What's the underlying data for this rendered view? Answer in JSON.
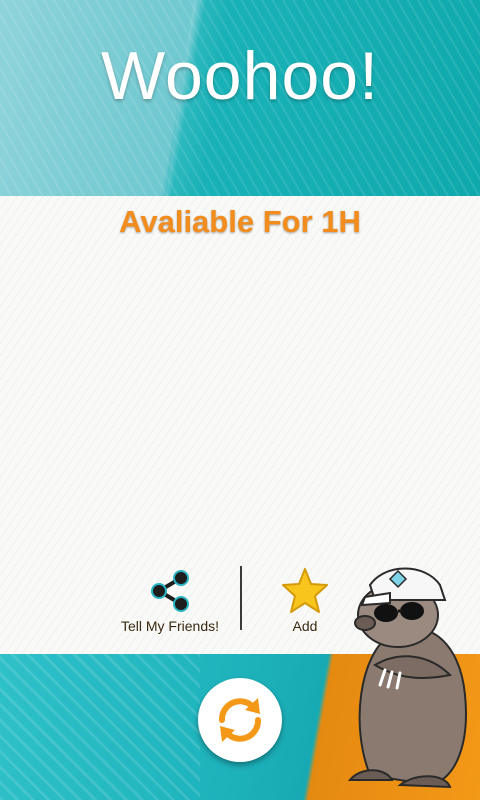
{
  "header": {
    "title": "Woohoo!"
  },
  "panel": {
    "availability": "Avaliable For 1H"
  },
  "actions": {
    "share": {
      "label": "Tell My Friends!",
      "icon": "share-icon"
    },
    "add": {
      "label": "Add",
      "icon": "star-icon"
    }
  },
  "refresh": {
    "icon": "refresh-icon",
    "color": "#f39817"
  },
  "colors": {
    "teal": "#19b2b8",
    "orange": "#f28c1d",
    "panel": "#f9f9f7"
  }
}
